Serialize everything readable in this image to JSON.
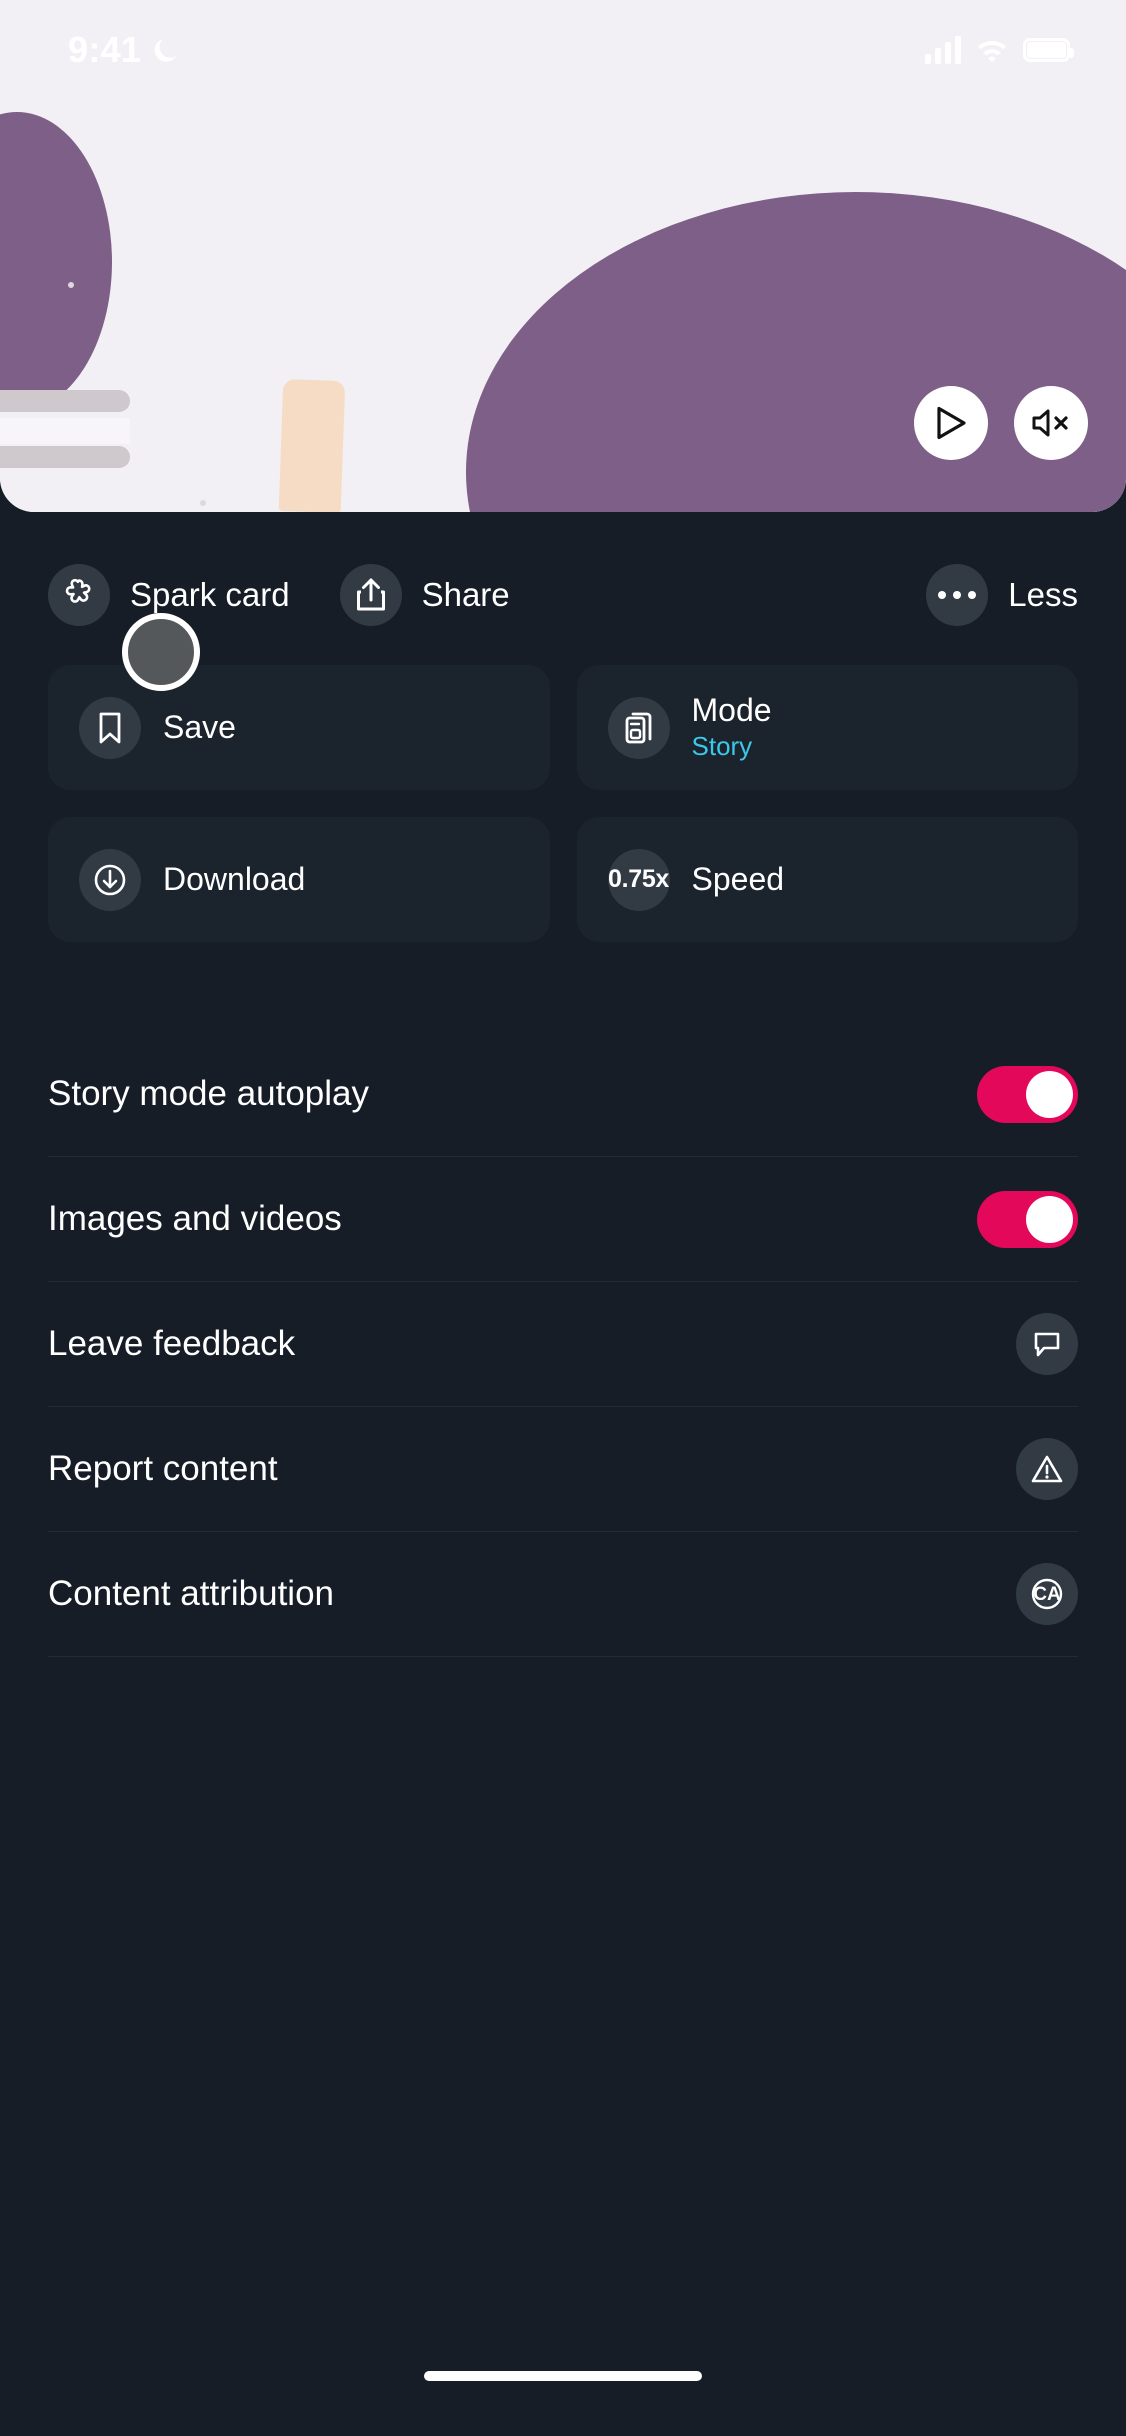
{
  "status_bar": {
    "time": "9:41",
    "dnd_icon": "crescent-moon-icon",
    "signal_icon": "cellular-signal-icon",
    "wifi_icon": "wifi-icon",
    "battery_icon": "battery-full-icon"
  },
  "media": {
    "play_button_label": "Play",
    "play_icon": "play-triangle-icon",
    "mute_button_label": "Mute",
    "mute_icon": "speaker-mute-icon"
  },
  "actions": [
    {
      "label": "Spark card",
      "icon": "spark-star-icon"
    },
    {
      "label": "Share",
      "icon": "share-upload-icon"
    },
    {
      "label": "Less",
      "icon": "ellipsis-icon"
    }
  ],
  "cards": [
    {
      "title": "Save",
      "sub": "",
      "icon": "bookmark-icon",
      "badge": ""
    },
    {
      "title": "Mode",
      "sub": "Story",
      "icon": "stacked-cards-icon",
      "badge": ""
    },
    {
      "title": "Download",
      "sub": "",
      "icon": "download-circle-icon",
      "badge": ""
    },
    {
      "title": "Speed",
      "sub": "",
      "icon": "speed-badge",
      "badge": "0.75x"
    }
  ],
  "settings": [
    {
      "label": "Story mode autoplay",
      "type": "toggle",
      "value": "on"
    },
    {
      "label": "Images and videos",
      "type": "toggle",
      "value": "on"
    },
    {
      "label": "Leave feedback",
      "type": "icon",
      "icon": "speech-bubble-icon"
    },
    {
      "label": "Report content",
      "type": "icon",
      "icon": "warning-triangle-icon"
    },
    {
      "label": "Content attribution",
      "type": "icon",
      "icon": "content-attribution-icon",
      "icon_text": "CA"
    }
  ],
  "colors": {
    "accent_toggle": "#e4085a",
    "accent_sub": "#3cc8e8",
    "background": "#161d26",
    "card": "#1b232d",
    "circle": "#323a44"
  },
  "home_indicator": "home-indicator-bar"
}
